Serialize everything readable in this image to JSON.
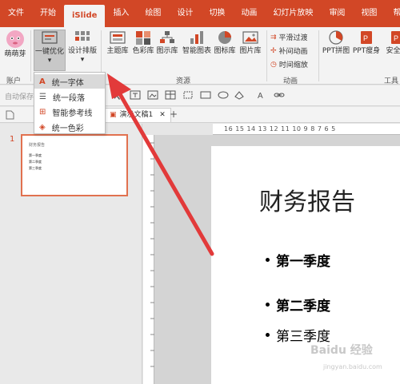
{
  "tabs": [
    "文件",
    "开始",
    "iSlide",
    "插入",
    "绘图",
    "设计",
    "切换",
    "动画",
    "幻灯片放映",
    "审阅",
    "视图",
    "帮助"
  ],
  "active_tab_index": 2,
  "ribbon": {
    "account_label": "萌萌芽",
    "account_group": "账户",
    "optimize_label": "一键优化",
    "layout_label": "设计排版",
    "resources": [
      "主题库",
      "色彩库",
      "图示库",
      "智能图表",
      "图标库",
      "图片库"
    ],
    "resources_group": "资源",
    "animation": [
      "平滑过渡",
      "补间动画",
      "时间缩放"
    ],
    "animation_group": "动画",
    "tools": [
      "PPT拼图",
      "PPT瘦身",
      "安全导"
    ],
    "tools_group": "工具"
  },
  "dropdown": {
    "items": [
      "统一字体",
      "统一段落",
      "智能参考线",
      "统一色彩"
    ],
    "highlighted_index": 0
  },
  "qat": {
    "autosave_label": "自动保存"
  },
  "doc": {
    "tab_name": "演示文稿1"
  },
  "thumbnail": {
    "number": "1",
    "title": "财务报告",
    "lines": [
      "第一季度",
      "第二季度",
      "第三季度"
    ]
  },
  "slide": {
    "title": "财务报告",
    "bullets": [
      "第一季度",
      "第二季度",
      "第三季度"
    ]
  },
  "ruler": {
    "label": "16  15  14  13  12  11  10  9  8  7  6  5"
  },
  "watermark": {
    "text": "Baidu 经验",
    "sub": "jingyan.baidu.com"
  },
  "colors": {
    "accent": "#d24726",
    "ribbon": "#f3f3f3",
    "arrow": "#e23a3a"
  }
}
